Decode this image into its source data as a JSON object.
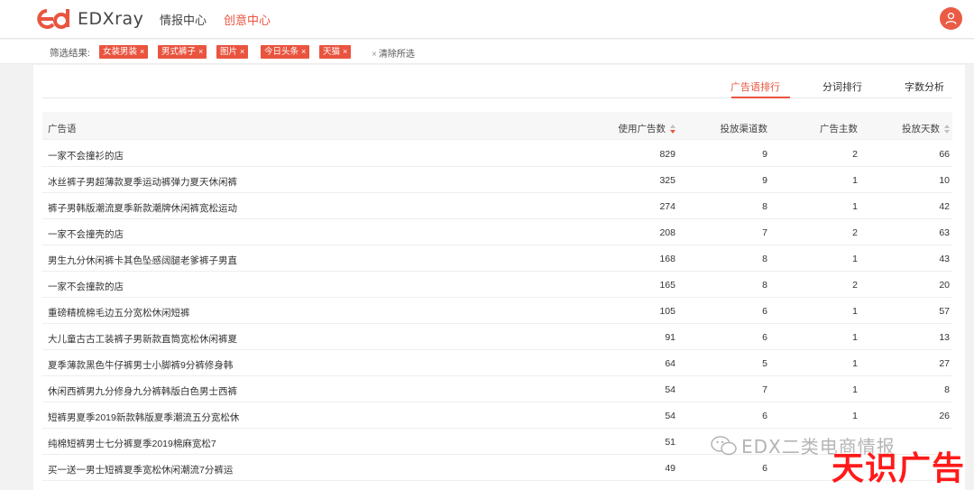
{
  "header": {
    "logo_text": "EDXray",
    "nav": [
      {
        "label": "情报中心",
        "active": false
      },
      {
        "label": "创意中心",
        "active": true
      }
    ]
  },
  "filters": {
    "label": "筛选结果:",
    "chips": [
      "女装男装",
      "男式裤子",
      "图片",
      "今日头条",
      "天猫"
    ],
    "clear_label": "清除所选"
  },
  "tabs": [
    {
      "label": "广告语排行",
      "active": true
    },
    {
      "label": "分词排行",
      "active": false
    },
    {
      "label": "字数分析",
      "active": false
    }
  ],
  "table": {
    "columns": [
      "广告语",
      "使用广告数",
      "投放渠道数",
      "广告主数",
      "投放天数"
    ],
    "rows": [
      [
        "一家不会撞衫的店",
        "829",
        "9",
        "2",
        "66"
      ],
      [
        "冰丝裤子男超薄款夏季运动裤弹力夏天休闲裤",
        "325",
        "9",
        "1",
        "10"
      ],
      [
        "裤子男韩版潮流夏季新款潮牌休闲裤宽松运动",
        "274",
        "8",
        "1",
        "42"
      ],
      [
        "一家不会撞壳的店",
        "208",
        "7",
        "2",
        "63"
      ],
      [
        "男生九分休闲裤卡其色坠感阔腿老爹裤子男直",
        "168",
        "8",
        "1",
        "43"
      ],
      [
        "一家不会撞款的店",
        "165",
        "8",
        "2",
        "20"
      ],
      [
        "重磅精梳棉毛边五分宽松休闲短裤",
        "105",
        "6",
        "1",
        "57"
      ],
      [
        "大儿童古古工装裤子男新款直筒宽松休闲裤夏",
        "91",
        "6",
        "1",
        "13"
      ],
      [
        "夏季薄款黑色牛仔裤男士小脚裤9分裤修身韩",
        "64",
        "5",
        "1",
        "27"
      ],
      [
        "休闲西裤男九分修身九分裤韩版白色男士西裤",
        "54",
        "7",
        "1",
        "8"
      ],
      [
        "短裤男夏季2019新款韩版夏季潮流五分宽松休",
        "54",
        "6",
        "1",
        "26"
      ],
      [
        "纯棉短裤男士七分裤夏季2019棉麻宽松7",
        "51",
        "",
        "",
        ""
      ],
      [
        "买一送一男士短裤夏季宽松休闲潮流7分裤运",
        "49",
        "6",
        "",
        ""
      ]
    ]
  },
  "watermark": {
    "wechat_text": "EDX二类电商情报",
    "brand_text": "天识广告"
  },
  "colors": {
    "accent": "#e9543f",
    "watermark_red": "#ff1a1a"
  }
}
